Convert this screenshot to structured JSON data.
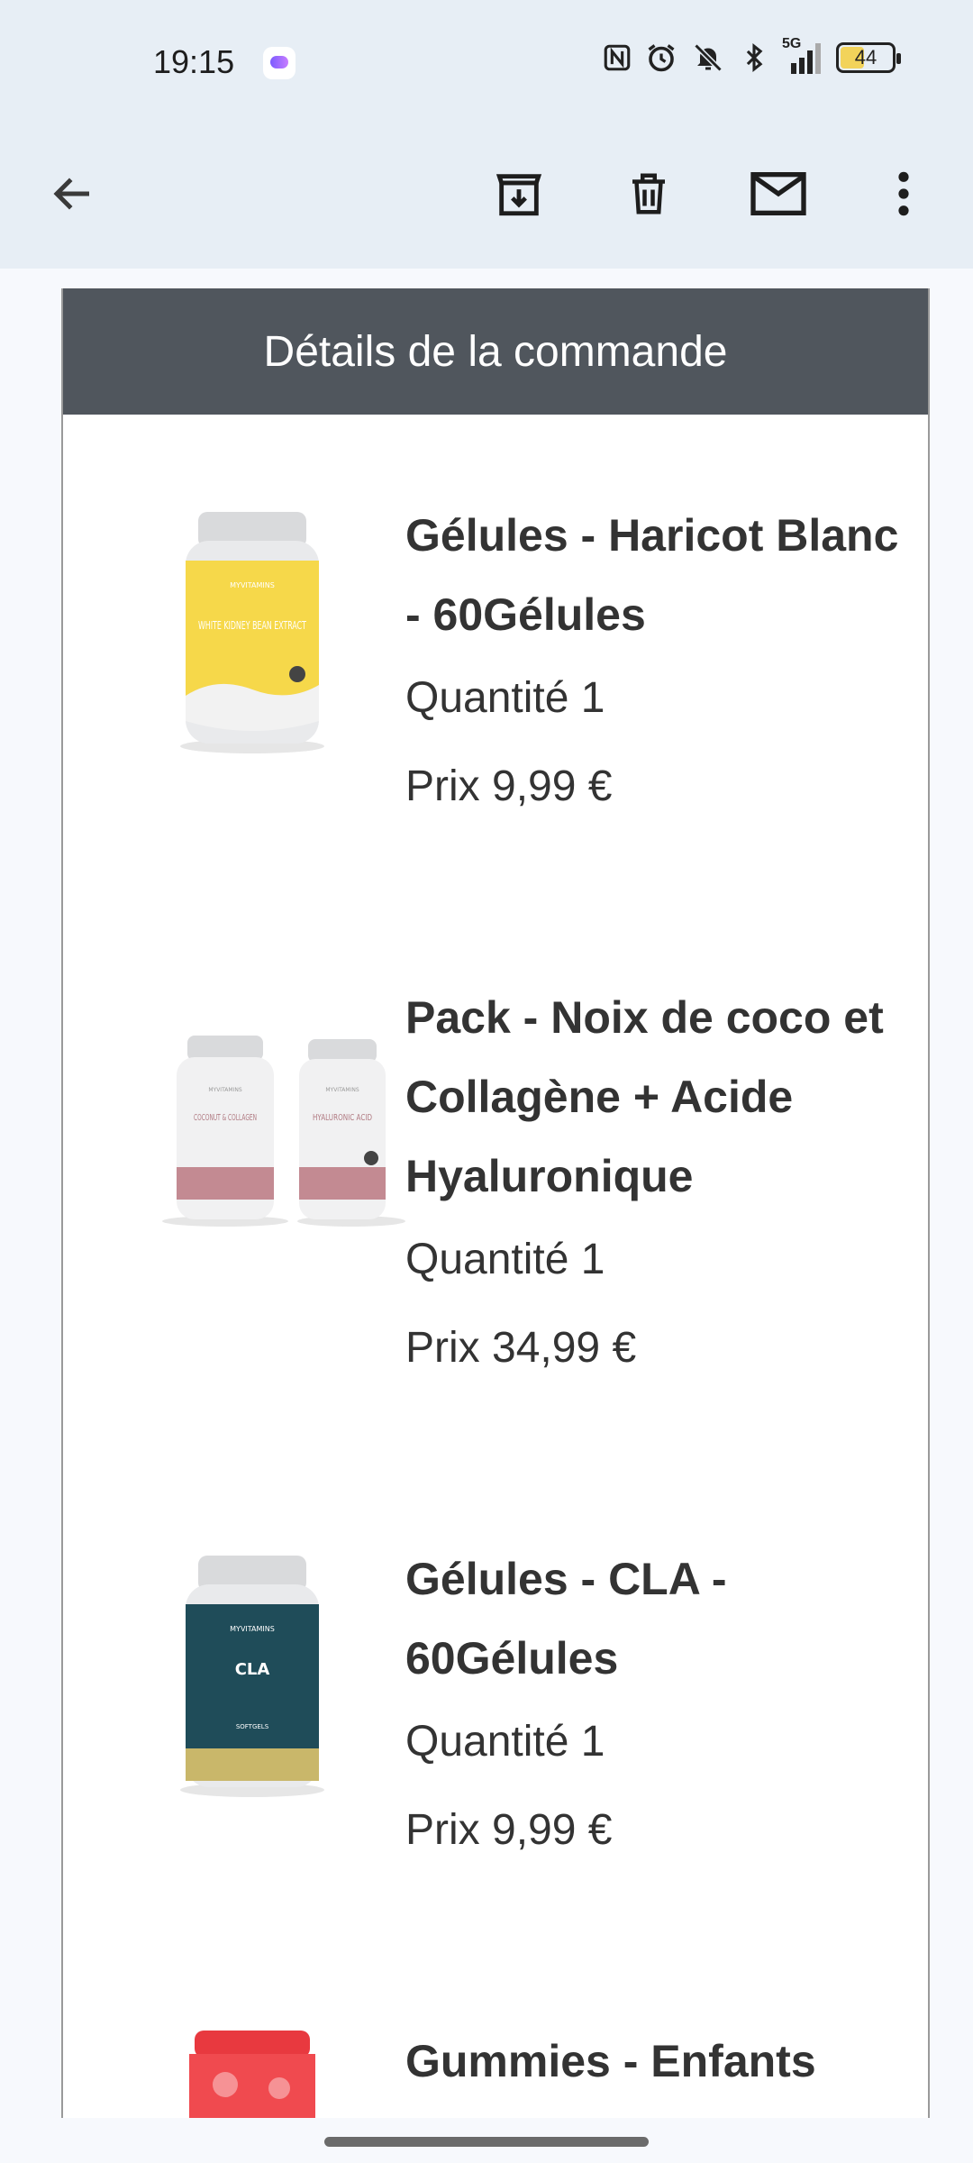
{
  "status_bar": {
    "time": "19:15",
    "network": "5G",
    "battery_level": "44",
    "battery_fraction": 0.44,
    "icons": [
      "app-notification-icon",
      "nfc-icon",
      "alarm-icon",
      "silent-icon",
      "bluetooth-icon",
      "signal-icon",
      "battery-icon"
    ]
  },
  "app_bar": {
    "icons": [
      "back-arrow-icon",
      "archive-icon",
      "delete-icon",
      "mark-unread-icon",
      "more-vert-icon"
    ]
  },
  "order": {
    "header": "Détails de la commande",
    "items": [
      {
        "title": "Gélules - Haricot Blanc - 60Gélules",
        "quantity": "Quantité 1",
        "price": "Prix 9,99 €"
      },
      {
        "title": "Pack - Noix de coco et Collagène + Acide Hyaluronique",
        "quantity": "Quantité 1",
        "price": "Prix 34,99 €"
      },
      {
        "title": "Gélules - CLA - 60Gélules",
        "quantity": "Quantité 1",
        "price": "Prix 9,99 €"
      },
      {
        "title": "Gummies - Enfants",
        "quantity": "",
        "price": ""
      }
    ]
  },
  "product_labels": {
    "brand": "MYVITAMINS",
    "white_kidney": "WHITE KIDNEY BEAN EXTRACT",
    "coconut": "COCONUT & COLLAGEN",
    "hyaluronic": "HYALURONIC ACID",
    "cla": "CLA",
    "cla_sub": "SOFTGELS"
  },
  "colors": {
    "header_bg": "#50565d",
    "bar_bg": "#e7eef5",
    "bottle_yellow": "#f6d84a",
    "bottle_teal": "#1f4c59",
    "bottle_pink": "#c38a92",
    "gummies_red": "#e8393f"
  }
}
